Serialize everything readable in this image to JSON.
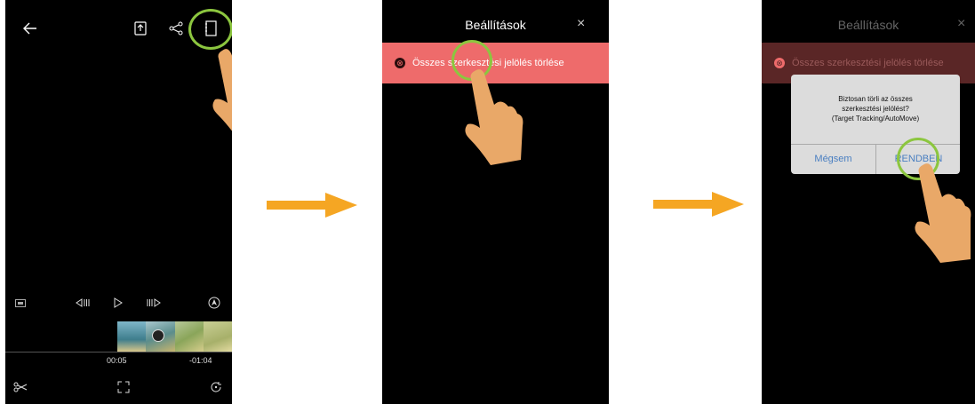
{
  "screen1": {
    "time_current": "00:05",
    "time_remaining": "-01:04",
    "icons": {
      "back": "back-arrow-icon",
      "export": "export-icon",
      "share": "share-icon",
      "settings": "settings-notebook-icon",
      "aspect": "aspect-ratio-icon",
      "prev_frame": "previous-frame-icon",
      "play": "play-icon",
      "next_frame": "next-frame-icon",
      "automove": "automove-icon",
      "scissors": "scissors-icon",
      "fullscreen": "fullscreen-icon",
      "rotate": "rotate-icon"
    }
  },
  "screen2": {
    "title": "Beállítások",
    "close": "×",
    "banner_text": "Összes szerkesztési jelölés törlése"
  },
  "screen3": {
    "title": "Beállítások",
    "close": "×",
    "banner_text": "Összes szerkesztési jelölés törlése",
    "dialog_line1": "Biztosan törli az összes",
    "dialog_line2": "szerkesztési jelölést?",
    "dialog_line3": "(Target Tracking/AutoMove)",
    "cancel_label": "Mégsem",
    "ok_label": "RENDBEN"
  },
  "colors": {
    "banner_active": "#ee6b6b",
    "banner_dimmed": "#5a2626",
    "highlight": "#8cc63f",
    "arrow": "#f5a623",
    "hand": "#e9a868"
  }
}
